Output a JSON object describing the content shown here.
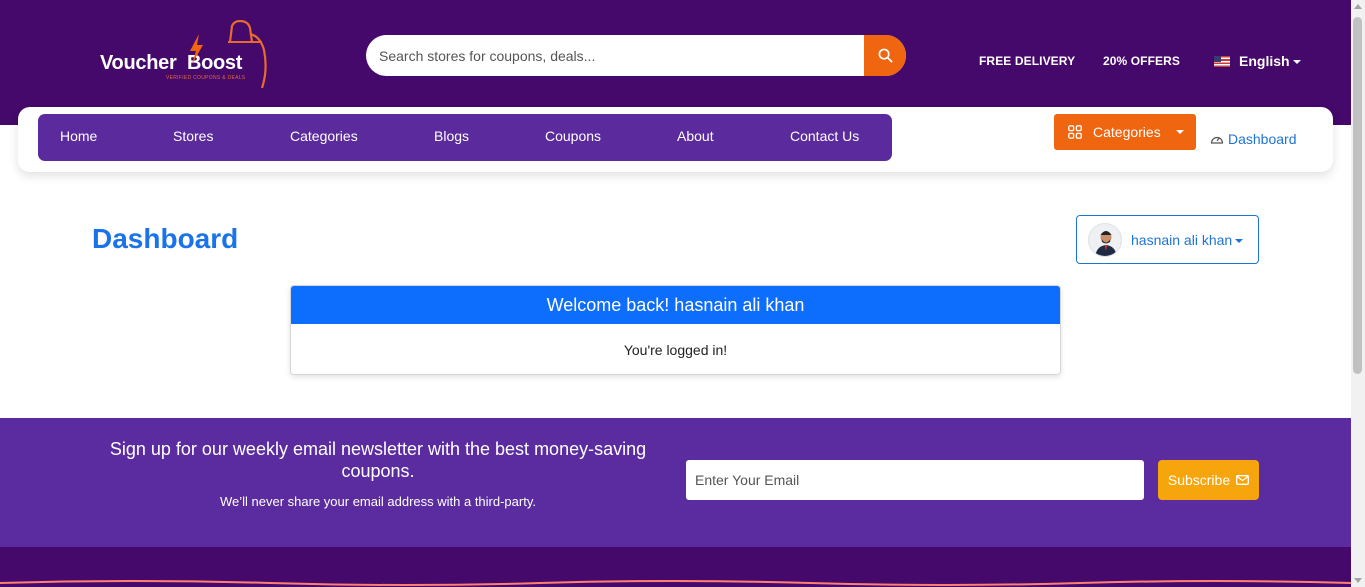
{
  "brand": {
    "name_part1": "Voucher",
    "name_part2": "Boost",
    "tagline": "VERIFIED COUPONS & DEALS",
    "accent_color": "#f0650f",
    "primary_color": "#45086b"
  },
  "search": {
    "placeholder": "Search stores for coupons, deals...",
    "button_icon": "search-icon"
  },
  "top_links": {
    "free_delivery": "FREE DELIVERY",
    "offers": "20% OFFERS",
    "language": "English",
    "language_icon": "us-flag-icon"
  },
  "nav": {
    "items": [
      {
        "label": "Home"
      },
      {
        "label": "Stores"
      },
      {
        "label": "Categories"
      },
      {
        "label": "Blogs"
      },
      {
        "label": "Coupons"
      },
      {
        "label": "About"
      },
      {
        "label": "Contact Us"
      }
    ],
    "categories_button": "Categories",
    "categories_icon": "grid-icon",
    "dashboard_link": "Dashboard",
    "dashboard_icon": "speedometer-icon"
  },
  "dashboard": {
    "title": "Dashboard",
    "user_name": "hasnain ali khan",
    "welcome": "Welcome back! hasnain ali khan",
    "status": "You're logged in!",
    "header_color": "#0d6efd"
  },
  "newsletter": {
    "title": "Sign up for our weekly email newsletter with the best money-saving coupons.",
    "subtitle": "We’ll never share your email address with a third-party.",
    "email_placeholder": "Enter Your Email",
    "subscribe_label": "Subscribe",
    "subscribe_icon": "envelope-icon",
    "button_color": "#f7a50d"
  }
}
